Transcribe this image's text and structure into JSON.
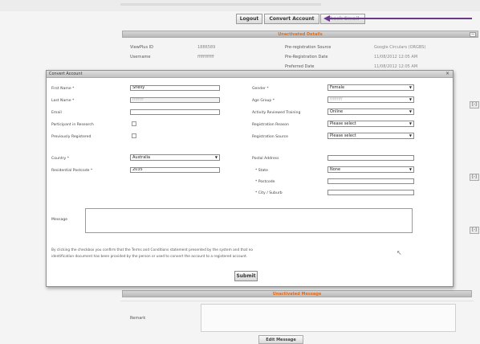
{
  "topbar": {
    "logout_label": "Logout",
    "convert_account_label": "Convert Account",
    "third_button_label": "Check Email"
  },
  "background": {
    "section1_title": "Unactivated Details",
    "info_left": [
      {
        "label": "ViewPlus ID",
        "value": "1886589"
      },
      {
        "label": "Username",
        "value": "ffffffffffff"
      },
      {
        "label": "",
        "value": ""
      }
    ],
    "info_right": [
      {
        "label": "Pre-registration Source",
        "value": "Google Circulars (ORGBS)"
      },
      {
        "label": "Pre-Registration Date",
        "value": "11/08/2012 12:05 AM"
      },
      {
        "label": "Preferred Date",
        "value": "11/08/2012 12:05 AM"
      }
    ],
    "side_buttons": [
      "[-]",
      "[-]",
      "[-]"
    ],
    "section2_title": "Unactivated Message",
    "message_label": "Remark",
    "send_button_label": "Edit Message"
  },
  "dialog": {
    "title": "Convert Account",
    "close_symbol": "×",
    "left": {
      "first_name_label": "First Name *",
      "first_name_value": "Shelly",
      "last_name_label": "Last Name *",
      "last_name_value": "ffffffff",
      "email_label": "Email",
      "email_value": "",
      "participant_label": "Participant in Research",
      "previously_label": "Previously Registered",
      "country_label": "Country *",
      "country_value": "Australia",
      "postcode_label": "Residential Postcode *",
      "postcode_value": "2035"
    },
    "right": {
      "gender_label": "Gender *",
      "gender_value": "Female",
      "age_label": "Age Group *",
      "age_value": "fffffffff",
      "activity_label": "Activity Reviewed Training",
      "activity_value": "Online",
      "reason_label": "Registration Reason",
      "reason_value": "Please select",
      "source_label": "Registration Source",
      "source_value": "Please select",
      "postal_label": "Postal Address",
      "state_label": "* State",
      "state_value": "None",
      "postcode_label": "* Postcode",
      "city_label": "* City / Suburb"
    },
    "message_label": "Message",
    "terms_line1": "By clicking the checkbox you confirm that the Terms and Conditions statement presented by the system and that no",
    "terms_line2": "identification document has been provided by the person or used to convert the account to a registered account.",
    "submit_label": "Submit"
  }
}
